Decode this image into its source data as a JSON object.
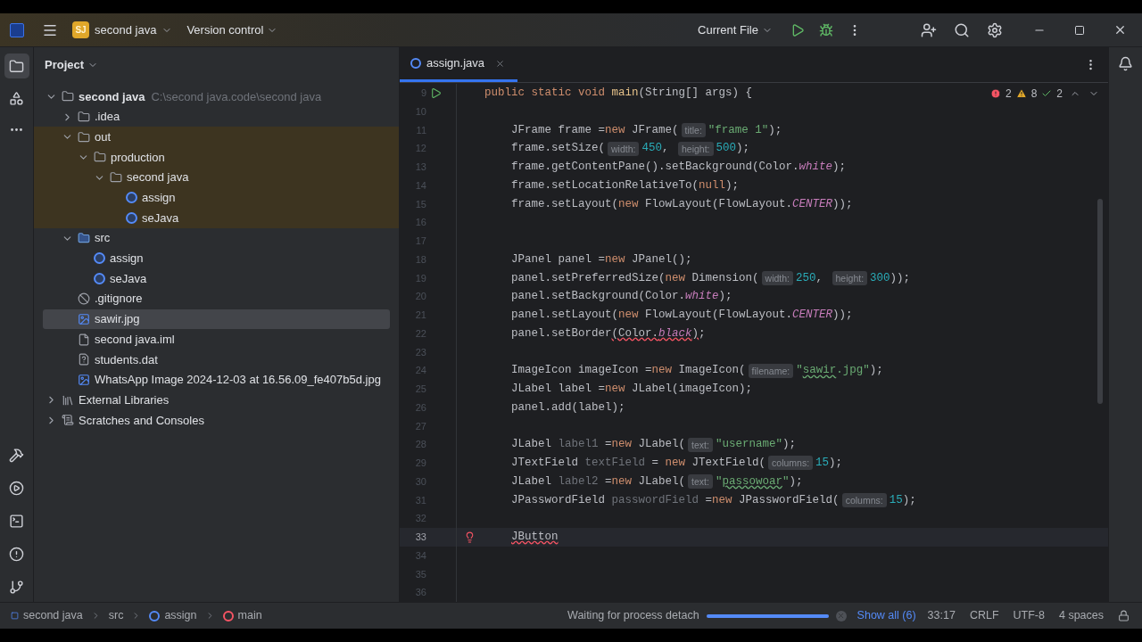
{
  "title_bar": {
    "project_badge": "SJ",
    "project": "second java",
    "vcs": "Version control",
    "run_config": "Current File"
  },
  "project_panel": {
    "title": "Project",
    "tree": [
      {
        "label": "second java",
        "kind": "module",
        "path": "C:\\second java.code\\second java",
        "expanded": true,
        "selected": false,
        "children": [
          {
            "label": ".idea",
            "kind": "folder",
            "expanded": false,
            "selected": false,
            "excluded": false
          },
          {
            "label": "out",
            "kind": "folder",
            "expanded": true,
            "selected": false,
            "excluded": true,
            "children": [
              {
                "label": "production",
                "kind": "folder",
                "expanded": true,
                "selected": false,
                "children": [
                  {
                    "label": "second java",
                    "kind": "folder",
                    "expanded": true,
                    "selected": false,
                    "children": [
                      {
                        "label": "assign",
                        "kind": "class",
                        "selected": false
                      },
                      {
                        "label": "seJava",
                        "kind": "class",
                        "selected": false
                      }
                    ]
                  }
                ]
              }
            ]
          },
          {
            "label": "src",
            "kind": "source",
            "expanded": true,
            "selected": false,
            "excluded": false,
            "children": [
              {
                "label": "assign",
                "kind": "class",
                "selected": false
              },
              {
                "label": "seJava",
                "kind": "class",
                "selected": false
              }
            ]
          },
          {
            "label": ".gitignore",
            "kind": "ignore",
            "selected": false,
            "excluded": false
          },
          {
            "label": "sawir.jpg",
            "kind": "image",
            "selected": true,
            "excluded": false
          },
          {
            "label": "second java.iml",
            "kind": "file",
            "selected": false,
            "excluded": false
          },
          {
            "label": "students.dat",
            "kind": "unknown",
            "selected": false,
            "excluded": false
          },
          {
            "label": "WhatsApp Image 2024-12-03 at 16.56.09_fe407b5d.jpg",
            "kind": "image",
            "selected": false,
            "excluded": false
          }
        ]
      },
      {
        "label": "External Libraries",
        "kind": "library",
        "expanded": false,
        "selected": false
      },
      {
        "label": "Scratches and Consoles",
        "kind": "scratches",
        "expanded": false,
        "selected": false
      }
    ]
  },
  "editor": {
    "tabs": [
      {
        "label": "assign.java",
        "selected": true
      }
    ],
    "inspections": {
      "errors": "2",
      "warnings": "8",
      "ok": "2"
    },
    "lines": [
      {
        "number": "9",
        "kind": "run",
        "current": false,
        "tokens": [
          {
            "text": "public static void ",
            "kind": "keyword"
          },
          {
            "text": "main",
            "kind": "decl"
          },
          {
            "text": "(String[] args) {",
            "kind": "plain"
          }
        ]
      },
      {
        "number": "10",
        "kind": "plain",
        "current": false
      },
      {
        "number": "11",
        "kind": "plain",
        "current": false,
        "tokens": [
          {
            "text": "JFrame frame =",
            "kind": "plain"
          },
          {
            "text": "new ",
            "kind": "keyword"
          },
          {
            "text": "JFrame(",
            "kind": "plain"
          },
          {
            "text": "title:",
            "kind": "hint"
          },
          {
            "text": "\"frame 1\"",
            "kind": "string"
          },
          {
            "text": ");",
            "kind": "plain"
          }
        ]
      },
      {
        "number": "12",
        "kind": "plain",
        "current": false,
        "tokens": [
          {
            "text": "frame.setSize(",
            "kind": "plain"
          },
          {
            "text": "width:",
            "kind": "hint"
          },
          {
            "text": "450",
            "kind": "number"
          },
          {
            "text": ", ",
            "kind": "plain"
          },
          {
            "text": "height:",
            "kind": "hint"
          },
          {
            "text": "500",
            "kind": "number"
          },
          {
            "text": ");",
            "kind": "plain"
          }
        ]
      },
      {
        "number": "13",
        "kind": "plain",
        "current": false,
        "tokens": [
          {
            "text": "frame.getContentPane().setBackground(Color.",
            "kind": "plain"
          },
          {
            "text": "white",
            "kind": "constant"
          },
          {
            "text": ");",
            "kind": "plain"
          }
        ]
      },
      {
        "number": "14",
        "kind": "plain",
        "current": false,
        "tokens": [
          {
            "text": "frame.setLocationRelativeTo(",
            "kind": "plain"
          },
          {
            "text": "null",
            "kind": "keyword"
          },
          {
            "text": ");",
            "kind": "plain"
          }
        ]
      },
      {
        "number": "15",
        "kind": "plain",
        "current": false,
        "tokens": [
          {
            "text": "frame.setLayout(",
            "kind": "plain"
          },
          {
            "text": "new ",
            "kind": "keyword"
          },
          {
            "text": "FlowLayout(FlowLayout.",
            "kind": "plain"
          },
          {
            "text": "CENTER",
            "kind": "constant"
          },
          {
            "text": "));",
            "kind": "plain"
          }
        ]
      },
      {
        "number": "16",
        "kind": "plain",
        "current": false
      },
      {
        "number": "17",
        "kind": "plain",
        "current": false
      },
      {
        "number": "18",
        "kind": "plain",
        "current": false,
        "tokens": [
          {
            "text": "JPanel panel =",
            "kind": "plain"
          },
          {
            "text": "new ",
            "kind": "keyword"
          },
          {
            "text": "JPanel();",
            "kind": "plain"
          }
        ]
      },
      {
        "number": "19",
        "kind": "plain",
        "current": false,
        "tokens": [
          {
            "text": "panel.setPreferredSize(",
            "kind": "plain"
          },
          {
            "text": "new ",
            "kind": "keyword"
          },
          {
            "text": "Dimension(",
            "kind": "plain"
          },
          {
            "text": "width:",
            "kind": "hint"
          },
          {
            "text": "250",
            "kind": "number"
          },
          {
            "text": ", ",
            "kind": "plain"
          },
          {
            "text": "height:",
            "kind": "hint"
          },
          {
            "text": "300",
            "kind": "number"
          },
          {
            "text": "));",
            "kind": "plain"
          }
        ]
      },
      {
        "number": "20",
        "kind": "plain",
        "current": false,
        "tokens": [
          {
            "text": "panel.setBackground(Color.",
            "kind": "plain"
          },
          {
            "text": "white",
            "kind": "constant"
          },
          {
            "text": ");",
            "kind": "plain"
          }
        ]
      },
      {
        "number": "21",
        "kind": "plain",
        "current": false,
        "tokens": [
          {
            "text": "panel.setLayout(",
            "kind": "plain"
          },
          {
            "text": "new ",
            "kind": "keyword"
          },
          {
            "text": "FlowLayout(FlowLayout.",
            "kind": "plain"
          },
          {
            "text": "CENTER",
            "kind": "constant"
          },
          {
            "text": "));",
            "kind": "plain"
          }
        ]
      },
      {
        "number": "22",
        "kind": "plain",
        "current": false,
        "tokens": [
          {
            "text": "panel.setBorder",
            "kind": "plain"
          },
          {
            "text": "(Color.",
            "kind": "error"
          },
          {
            "text": "black",
            "kind": "error_constant"
          },
          {
            "text": ")",
            "kind": "error"
          },
          {
            "text": ";",
            "kind": "plain"
          }
        ]
      },
      {
        "number": "23",
        "kind": "plain",
        "current": false
      },
      {
        "number": "24",
        "kind": "plain",
        "current": false,
        "tokens": [
          {
            "text": "ImageIcon imageIcon =",
            "kind": "plain"
          },
          {
            "text": "new ",
            "kind": "keyword"
          },
          {
            "text": "ImageIcon(",
            "kind": "plain"
          },
          {
            "text": "filename:",
            "kind": "hint"
          },
          {
            "text": "\"",
            "kind": "string"
          },
          {
            "text": "sawir",
            "kind": "typo"
          },
          {
            "text": ".jpg\"",
            "kind": "string"
          },
          {
            "text": ");",
            "kind": "plain"
          }
        ]
      },
      {
        "number": "25",
        "kind": "plain",
        "current": false,
        "tokens": [
          {
            "text": "JLabel label =",
            "kind": "plain"
          },
          {
            "text": "new ",
            "kind": "keyword"
          },
          {
            "text": "JLabel(imageIcon);",
            "kind": "plain"
          }
        ]
      },
      {
        "number": "26",
        "kind": "plain",
        "current": false,
        "tokens": [
          {
            "text": "panel.add(label);",
            "kind": "plain"
          }
        ]
      },
      {
        "number": "27",
        "kind": "plain",
        "current": false
      },
      {
        "number": "28",
        "kind": "plain",
        "current": false,
        "tokens": [
          {
            "text": "JLabel ",
            "kind": "plain"
          },
          {
            "text": "label1 ",
            "kind": "unused"
          },
          {
            "text": "=",
            "kind": "plain"
          },
          {
            "text": "new ",
            "kind": "keyword"
          },
          {
            "text": "JLabel(",
            "kind": "plain"
          },
          {
            "text": "text:",
            "kind": "hint"
          },
          {
            "text": "\"username\"",
            "kind": "string"
          },
          {
            "text": ");",
            "kind": "plain"
          }
        ]
      },
      {
        "number": "29",
        "kind": "plain",
        "current": false,
        "tokens": [
          {
            "text": "JTextField ",
            "kind": "plain"
          },
          {
            "text": "textField ",
            "kind": "unused"
          },
          {
            "text": "= ",
            "kind": "plain"
          },
          {
            "text": "new ",
            "kind": "keyword"
          },
          {
            "text": "JTextField(",
            "kind": "plain"
          },
          {
            "text": "columns:",
            "kind": "hint"
          },
          {
            "text": "15",
            "kind": "number"
          },
          {
            "text": ");",
            "kind": "plain"
          }
        ]
      },
      {
        "number": "30",
        "kind": "plain",
        "current": false,
        "tokens": [
          {
            "text": "JLabel ",
            "kind": "plain"
          },
          {
            "text": "label2 ",
            "kind": "unused"
          },
          {
            "text": "=",
            "kind": "plain"
          },
          {
            "text": "new ",
            "kind": "keyword"
          },
          {
            "text": "JLabel(",
            "kind": "plain"
          },
          {
            "text": "text:",
            "kind": "hint"
          },
          {
            "text": "\"",
            "kind": "string"
          },
          {
            "text": "passowoar",
            "kind": "typo"
          },
          {
            "text": "\"",
            "kind": "string"
          },
          {
            "text": ");",
            "kind": "plain"
          }
        ]
      },
      {
        "number": "31",
        "kind": "plain",
        "current": false,
        "tokens": [
          {
            "text": "JPasswordField ",
            "kind": "plain"
          },
          {
            "text": "passwordField ",
            "kind": "unused"
          },
          {
            "text": "=",
            "kind": "plain"
          },
          {
            "text": "new ",
            "kind": "keyword"
          },
          {
            "text": "JPasswordField(",
            "kind": "plain"
          },
          {
            "text": "columns:",
            "kind": "hint"
          },
          {
            "text": "15",
            "kind": "number"
          },
          {
            "text": ");",
            "kind": "plain"
          }
        ]
      },
      {
        "number": "32",
        "kind": "plain",
        "current": false
      },
      {
        "number": "33",
        "kind": "error",
        "current": true,
        "tokens": [
          {
            "text": "JButton",
            "kind": "error"
          }
        ]
      },
      {
        "number": "34",
        "kind": "plain",
        "current": false
      },
      {
        "number": "35",
        "kind": "plain",
        "current": false
      },
      {
        "number": "36",
        "kind": "plain",
        "current": false
      }
    ]
  },
  "status_bar": {
    "breadcrumbs": [
      {
        "label": "second java",
        "kind": "module"
      },
      {
        "label": "src",
        "kind": "plain"
      },
      {
        "label": "assign",
        "kind": "class"
      },
      {
        "label": "main",
        "kind": "method"
      }
    ],
    "process": "Waiting for process detach",
    "progress": {
      "level": 1
    },
    "show_all": "Show all (6)",
    "position": "33:17",
    "line_ending": "CRLF",
    "encoding": "UTF-8",
    "indent": "4 spaces"
  }
}
